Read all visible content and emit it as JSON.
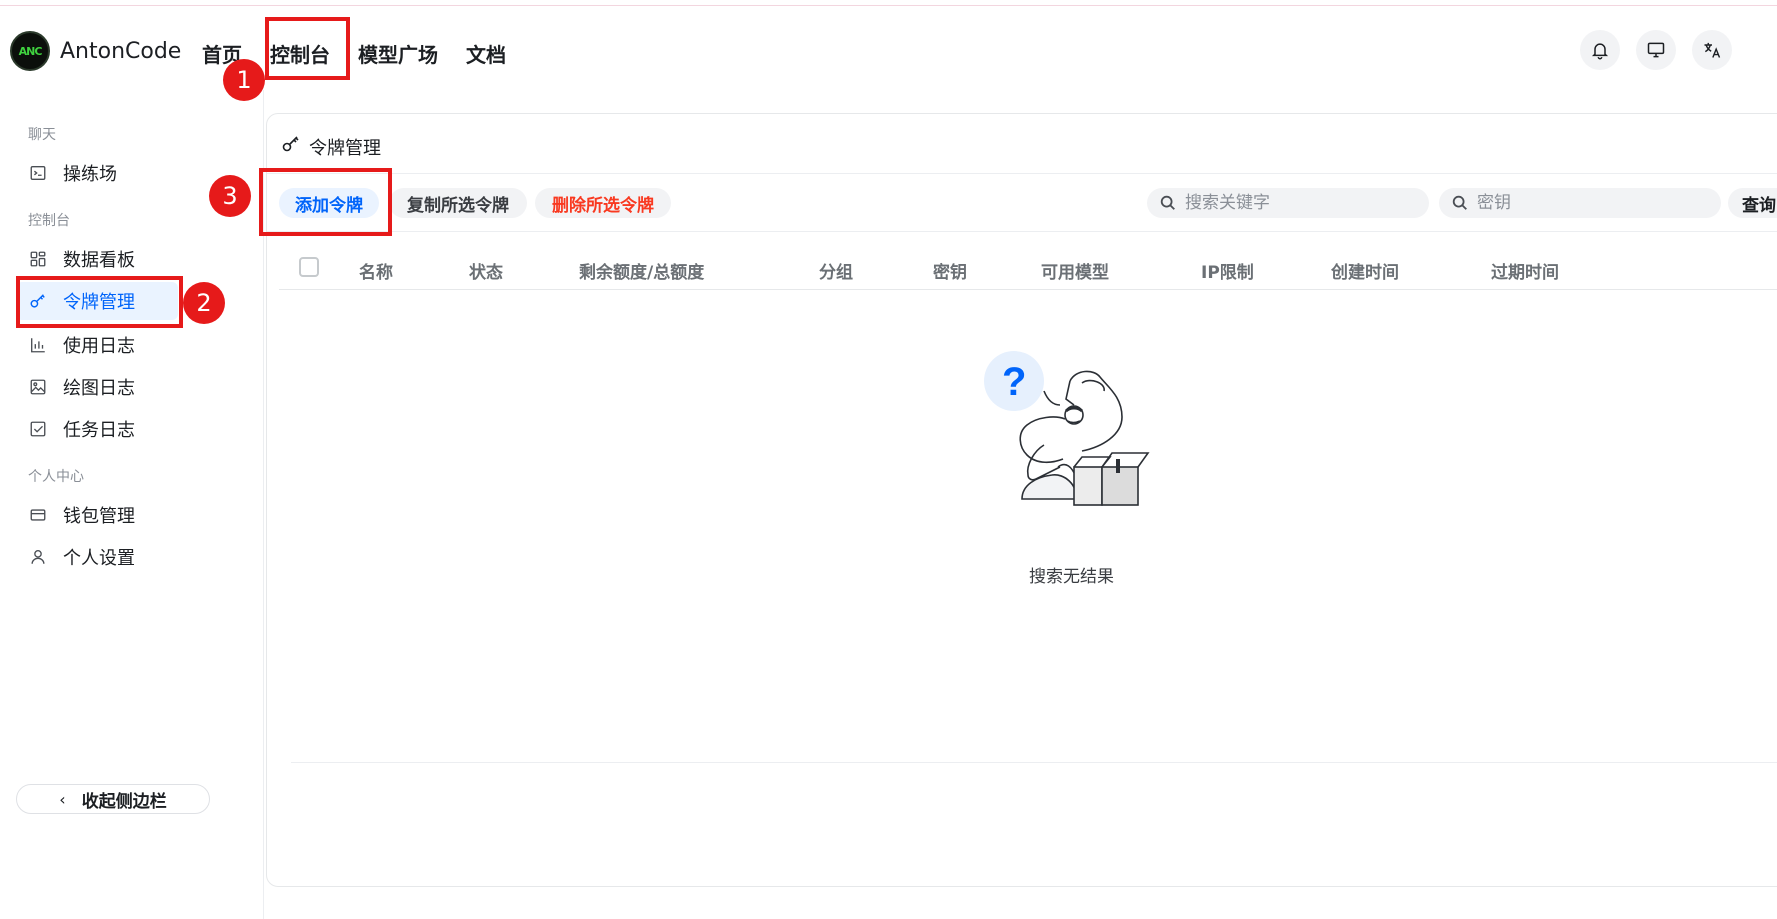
{
  "app": {
    "name": "AntonCode",
    "logo_text": "ANC"
  },
  "nav": [
    {
      "label": "首页"
    },
    {
      "label": "控制台"
    },
    {
      "label": "模型广场"
    },
    {
      "label": "文档"
    }
  ],
  "header_icons": [
    "bell-icon",
    "monitor-icon",
    "translate-icon"
  ],
  "sidebar": {
    "group_chat": "聊天",
    "item_playground": "操练场",
    "group_console": "控制台",
    "item_dashboard": "数据看板",
    "item_tokens": "令牌管理",
    "item_usage_log": "使用日志",
    "item_drawing_log": "绘图日志",
    "item_task_log": "任务日志",
    "group_personal": "个人中心",
    "item_wallet": "钱包管理",
    "item_settings": "个人设置",
    "collapse_label": "收起侧边栏",
    "active_item": "令牌管理"
  },
  "page": {
    "title": "令牌管理",
    "add_button": "添加令牌",
    "copy_button": "复制所选令牌",
    "delete_button": "删除所选令牌",
    "search_keyword_placeholder": "搜索关键字",
    "search_key_placeholder": "密钥",
    "query_button": "查询"
  },
  "table": {
    "columns": [
      "名称",
      "状态",
      "剩余额度/总额度",
      "分组",
      "密钥",
      "可用模型",
      "IP限制",
      "创建时间",
      "过期时间"
    ],
    "rows": [],
    "empty_text": "搜索无结果"
  },
  "annotations": [
    "1",
    "2",
    "3"
  ],
  "colors": {
    "accent": "#0064fa",
    "danger": "#f93920",
    "annotation": "#e61a1a",
    "active_bg": "#eaf3ff"
  }
}
